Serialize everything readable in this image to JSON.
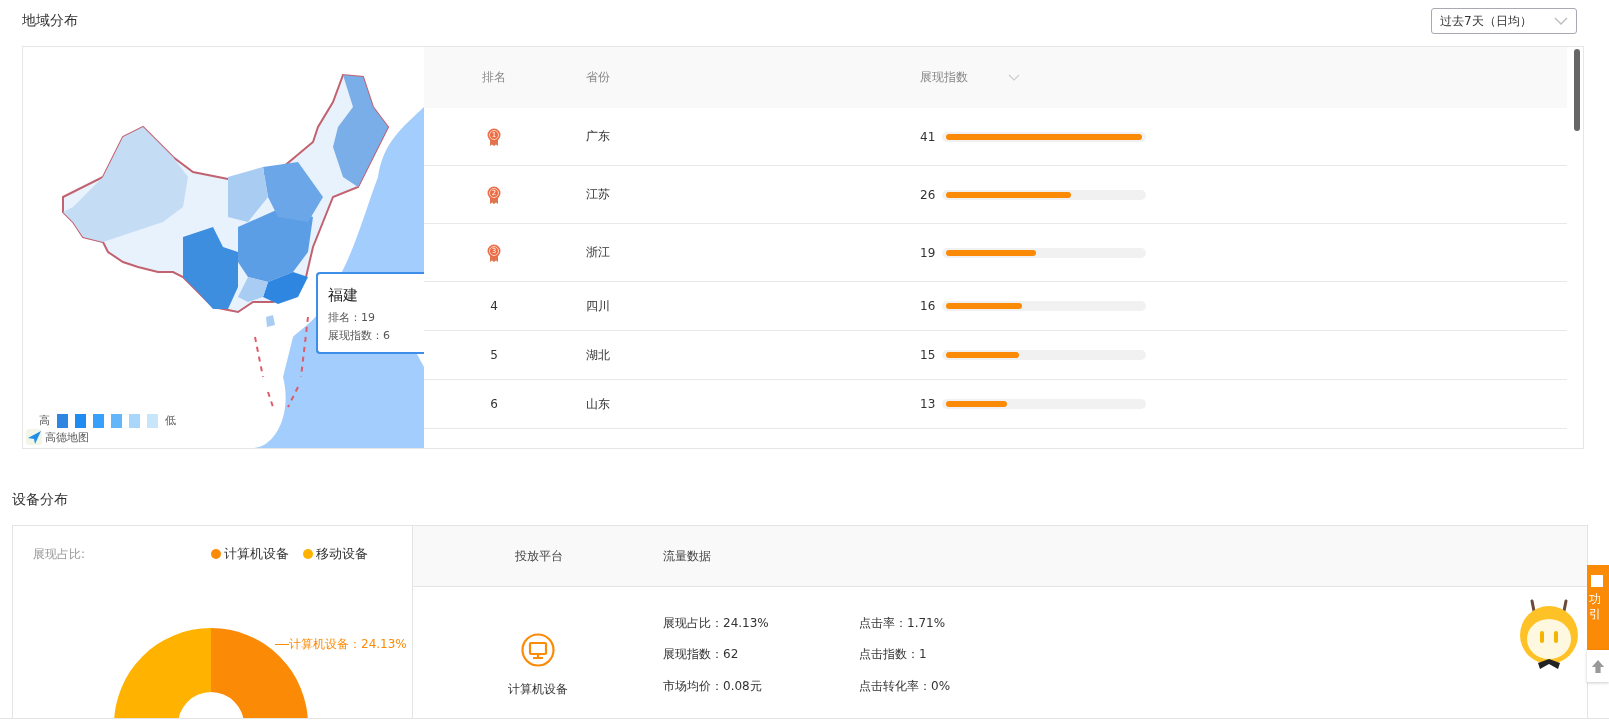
{
  "region": {
    "title": "地域分布",
    "period": "过去7天（日均）",
    "map": {
      "tooltip": {
        "name": "福建",
        "rank": "排名：19",
        "value": "展现指数：6"
      },
      "legend_high": "高",
      "legend_low": "低",
      "provider": "高德地图"
    },
    "table": {
      "columns": [
        "排名",
        "省份",
        "展现指数"
      ],
      "rows": [
        {
          "kind": "medal",
          "rank": "1",
          "province": "广东",
          "value": "41",
          "level": 1.0
        },
        {
          "kind": "medal",
          "rank": "2",
          "province": "江苏",
          "value": "26",
          "level": 0.64
        },
        {
          "kind": "medal",
          "rank": "3",
          "province": "浙江",
          "value": "19",
          "level": 0.46
        },
        {
          "kind": "number",
          "rank": "4",
          "province": "四川",
          "value": "16",
          "level": 0.39
        },
        {
          "kind": "number",
          "rank": "5",
          "province": "湖北",
          "value": "15",
          "level": 0.37
        },
        {
          "kind": "number",
          "rank": "6",
          "province": "山东",
          "value": "13",
          "level": 0.31
        }
      ]
    }
  },
  "device": {
    "title": "设备分布",
    "share_label": "展现占比:",
    "legend": [
      {
        "label": "计算机设备",
        "color": "#fb8a06"
      },
      {
        "label": "移动设备",
        "color": "#ffb300"
      }
    ],
    "donut_label": "计算机设备：24.13%",
    "columns": [
      "投放平台",
      "流量数据"
    ],
    "rows": [
      {
        "platform": "计算机设备",
        "stats": [
          "展现占比：24.13%",
          "点击率：1.71%",
          "展现指数：62",
          "点击指数：1",
          "市场均价：0.08元",
          "点击转化率：0%"
        ]
      }
    ]
  },
  "side_tab": [
    "功",
    "引"
  ]
}
